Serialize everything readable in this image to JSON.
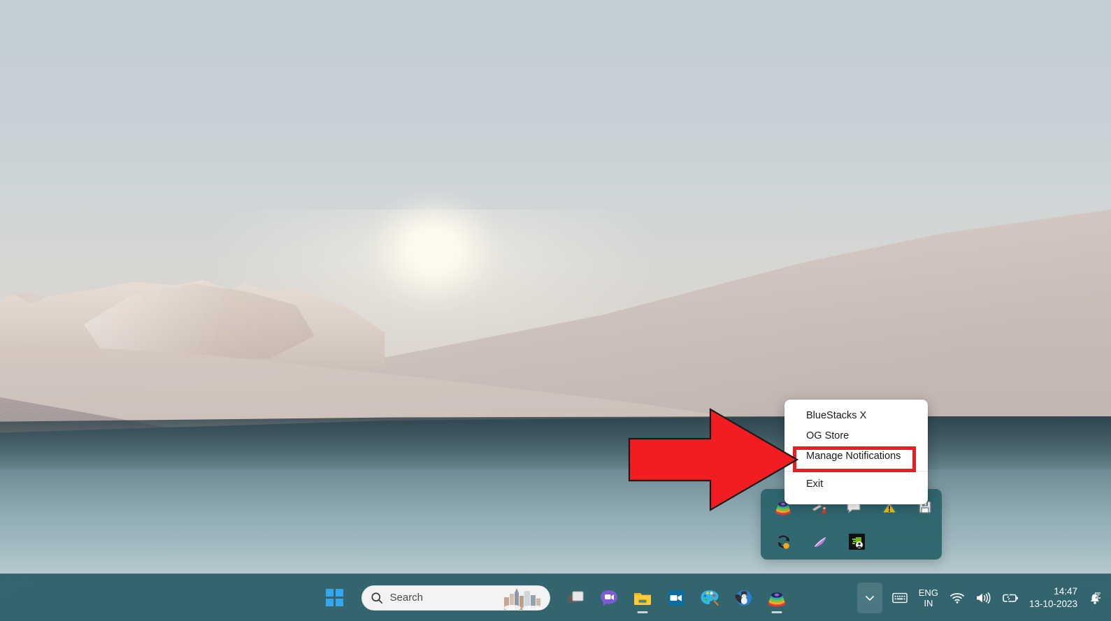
{
  "desktop": {
    "wallpaper_name": "windows-11-sand-dune-wallpaper",
    "accent_taskbar_color": "#295e67",
    "highlight_color": "#ec1c24"
  },
  "context_menu": {
    "name": "bluestacks-tray-context-menu",
    "items": [
      {
        "label": "BlueStacks X",
        "highlighted": false
      },
      {
        "label": "OG Store",
        "highlighted": false
      },
      {
        "label": "Manage Notifications",
        "highlighted": true
      },
      {
        "label": "Exit",
        "highlighted": false
      }
    ],
    "separator_after_index": 2
  },
  "annotation": {
    "arrow_icon": "red-right-arrow-icon",
    "arrow_color": "#f21c21",
    "target_label": "Manage Notifications"
  },
  "tray_flyout": {
    "name": "hidden-icons-flyout",
    "rows": [
      [
        {
          "icon": "bluestacks-icon",
          "label": "BlueStacks"
        },
        {
          "icon": "traffic-cone-icon",
          "label": "Traffic Cone"
        },
        {
          "icon": "speech-bubble-icon",
          "label": "Message"
        },
        {
          "icon": "warning-triangle-icon",
          "label": "Warning"
        },
        {
          "icon": "save-floppy-icon",
          "label": "Save"
        }
      ],
      [
        {
          "icon": "sync-refresh-icon",
          "label": "Sync"
        },
        {
          "icon": "feather-pen-icon",
          "label": "Feather"
        },
        {
          "icon": "green-app-icon",
          "label": "App"
        }
      ]
    ]
  },
  "taskbar": {
    "start_button": {
      "label": "Start",
      "icon": "windows-logo-icon"
    },
    "search": {
      "placeholder": "Search",
      "icon": "search-icon",
      "thumbnail": "cityscape-thumbnail"
    },
    "pinned_apps": [
      {
        "icon": "task-view-icon",
        "label": "Task View",
        "running": false
      },
      {
        "icon": "chat-icon",
        "label": "Chat",
        "running": false
      },
      {
        "icon": "file-explorer-icon",
        "label": "File Explorer",
        "running": true
      },
      {
        "icon": "outlook-icon",
        "label": "Outlook",
        "running": false
      },
      {
        "icon": "paint-icon",
        "label": "Paint",
        "running": false
      },
      {
        "icon": "batman-game-icon",
        "label": "Game",
        "running": false
      },
      {
        "icon": "bluestacks-icon",
        "label": "BlueStacks",
        "running": true
      }
    ],
    "system_tray": {
      "chevron": {
        "icon": "chevron-down-icon",
        "label": "Show hidden icons",
        "expanded": true
      },
      "keyboard": {
        "icon": "keyboard-ime-icon",
        "label": "Touch keyboard"
      },
      "language": {
        "line1": "ENG",
        "line2": "IN"
      },
      "network": {
        "icon": "wifi-icon",
        "label": "Network"
      },
      "volume": {
        "icon": "speaker-icon",
        "label": "Volume"
      },
      "battery": {
        "icon": "battery-charging-icon",
        "label": "Battery"
      },
      "clock": {
        "time": "14:47",
        "date": "13-10-2023"
      },
      "notifications": {
        "icon": "bell-dnd-icon",
        "label": "Do not disturb"
      }
    }
  }
}
